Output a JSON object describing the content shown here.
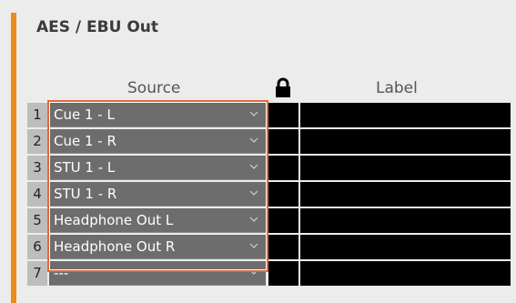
{
  "panel": {
    "title": "AES / EBU Out",
    "source_header": "Source",
    "label_header": "Label",
    "accent_color": "#f08a1c",
    "highlight_color": "#e2693a"
  },
  "rows": [
    {
      "num": "1",
      "source": "Cue 1 - L"
    },
    {
      "num": "2",
      "source": "Cue 1 - R"
    },
    {
      "num": "3",
      "source": "STU 1 - L"
    },
    {
      "num": "4",
      "source": "STU 1 - R"
    },
    {
      "num": "5",
      "source": "Headphone Out L"
    },
    {
      "num": "6",
      "source": "Headphone Out R"
    },
    {
      "num": "7",
      "source": "---"
    }
  ],
  "icons": {
    "lock": "lock-icon",
    "dropdown": "chevron-down-icon"
  }
}
